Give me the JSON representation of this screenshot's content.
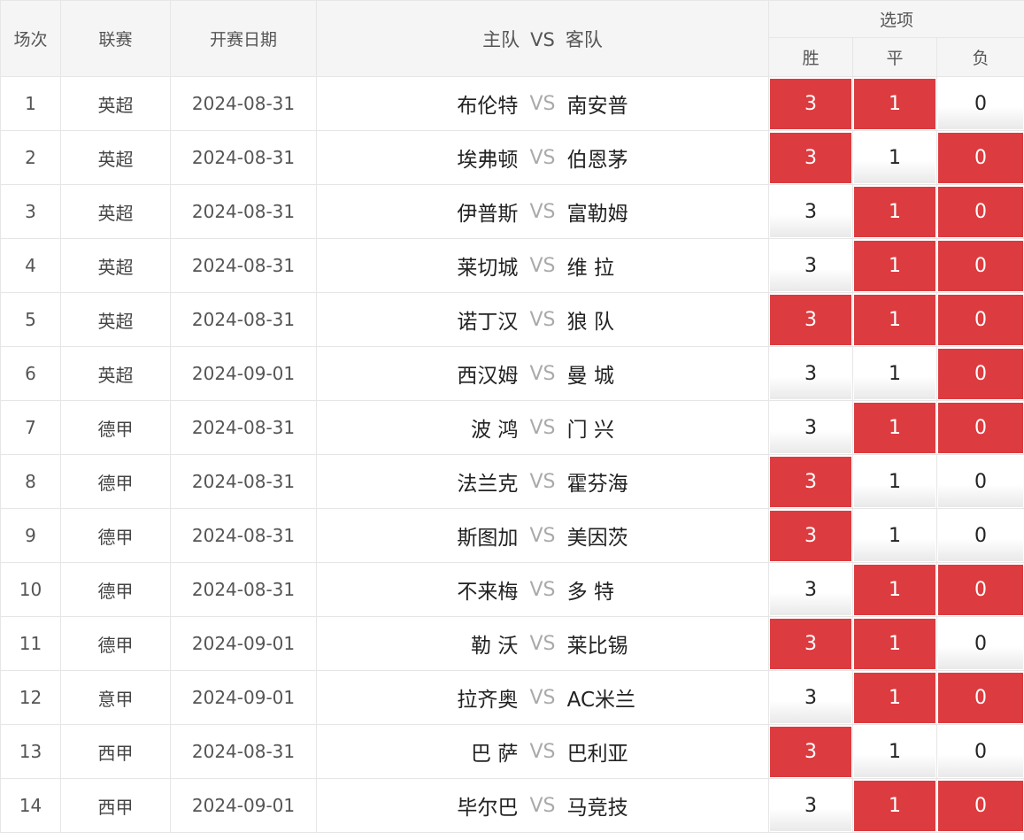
{
  "headers": {
    "round": "场次",
    "league": "联赛",
    "date": "开赛日期",
    "home": "主队",
    "vs": "VS",
    "away": "客队",
    "options_group": "选项",
    "win": "胜",
    "draw": "平",
    "loss": "负"
  },
  "colors": {
    "selected_bg": "#dc3b3f",
    "selected_text": "#ffffff",
    "header_bg": "#f5f5f5",
    "border": "#e6e6e6"
  },
  "matches": [
    {
      "round": "1",
      "league": "英超",
      "date": "2024-08-31",
      "home": "布伦特",
      "vs": "VS",
      "away": "南安普",
      "options": [
        {
          "label": "3",
          "selected": true
        },
        {
          "label": "1",
          "selected": true
        },
        {
          "label": "0",
          "selected": false
        }
      ]
    },
    {
      "round": "2",
      "league": "英超",
      "date": "2024-08-31",
      "home": "埃弗顿",
      "vs": "VS",
      "away": "伯恩茅",
      "options": [
        {
          "label": "3",
          "selected": true
        },
        {
          "label": "1",
          "selected": false
        },
        {
          "label": "0",
          "selected": true
        }
      ]
    },
    {
      "round": "3",
      "league": "英超",
      "date": "2024-08-31",
      "home": "伊普斯",
      "vs": "VS",
      "away": "富勒姆",
      "options": [
        {
          "label": "3",
          "selected": false
        },
        {
          "label": "1",
          "selected": true
        },
        {
          "label": "0",
          "selected": true
        }
      ]
    },
    {
      "round": "4",
      "league": "英超",
      "date": "2024-08-31",
      "home": "莱切城",
      "vs": "VS",
      "away": "维 拉",
      "options": [
        {
          "label": "3",
          "selected": false
        },
        {
          "label": "1",
          "selected": true
        },
        {
          "label": "0",
          "selected": true
        }
      ]
    },
    {
      "round": "5",
      "league": "英超",
      "date": "2024-08-31",
      "home": "诺丁汉",
      "vs": "VS",
      "away": "狼 队",
      "options": [
        {
          "label": "3",
          "selected": true
        },
        {
          "label": "1",
          "selected": true
        },
        {
          "label": "0",
          "selected": true
        }
      ]
    },
    {
      "round": "6",
      "league": "英超",
      "date": "2024-09-01",
      "home": "西汉姆",
      "vs": "VS",
      "away": "曼 城",
      "options": [
        {
          "label": "3",
          "selected": false
        },
        {
          "label": "1",
          "selected": false
        },
        {
          "label": "0",
          "selected": true
        }
      ]
    },
    {
      "round": "7",
      "league": "德甲",
      "date": "2024-08-31",
      "home": "波 鸿",
      "vs": "VS",
      "away": "门 兴",
      "options": [
        {
          "label": "3",
          "selected": false
        },
        {
          "label": "1",
          "selected": true
        },
        {
          "label": "0",
          "selected": true
        }
      ]
    },
    {
      "round": "8",
      "league": "德甲",
      "date": "2024-08-31",
      "home": "法兰克",
      "vs": "VS",
      "away": "霍芬海",
      "options": [
        {
          "label": "3",
          "selected": true
        },
        {
          "label": "1",
          "selected": false
        },
        {
          "label": "0",
          "selected": false
        }
      ]
    },
    {
      "round": "9",
      "league": "德甲",
      "date": "2024-08-31",
      "home": "斯图加",
      "vs": "VS",
      "away": "美因茨",
      "options": [
        {
          "label": "3",
          "selected": true
        },
        {
          "label": "1",
          "selected": false
        },
        {
          "label": "0",
          "selected": false
        }
      ]
    },
    {
      "round": "10",
      "league": "德甲",
      "date": "2024-08-31",
      "home": "不来梅",
      "vs": "VS",
      "away": "多 特",
      "options": [
        {
          "label": "3",
          "selected": false
        },
        {
          "label": "1",
          "selected": true
        },
        {
          "label": "0",
          "selected": true
        }
      ]
    },
    {
      "round": "11",
      "league": "德甲",
      "date": "2024-09-01",
      "home": "勒 沃",
      "vs": "VS",
      "away": "莱比锡",
      "options": [
        {
          "label": "3",
          "selected": true
        },
        {
          "label": "1",
          "selected": true
        },
        {
          "label": "0",
          "selected": false
        }
      ]
    },
    {
      "round": "12",
      "league": "意甲",
      "date": "2024-09-01",
      "home": "拉齐奥",
      "vs": "VS",
      "away": "AC米兰",
      "options": [
        {
          "label": "3",
          "selected": false
        },
        {
          "label": "1",
          "selected": true
        },
        {
          "label": "0",
          "selected": true
        }
      ]
    },
    {
      "round": "13",
      "league": "西甲",
      "date": "2024-08-31",
      "home": "巴 萨",
      "vs": "VS",
      "away": "巴利亚",
      "options": [
        {
          "label": "3",
          "selected": true
        },
        {
          "label": "1",
          "selected": false
        },
        {
          "label": "0",
          "selected": false
        }
      ]
    },
    {
      "round": "14",
      "league": "西甲",
      "date": "2024-09-01",
      "home": "毕尔巴",
      "vs": "VS",
      "away": "马竞技",
      "options": [
        {
          "label": "3",
          "selected": false
        },
        {
          "label": "1",
          "selected": true
        },
        {
          "label": "0",
          "selected": true
        }
      ]
    }
  ]
}
